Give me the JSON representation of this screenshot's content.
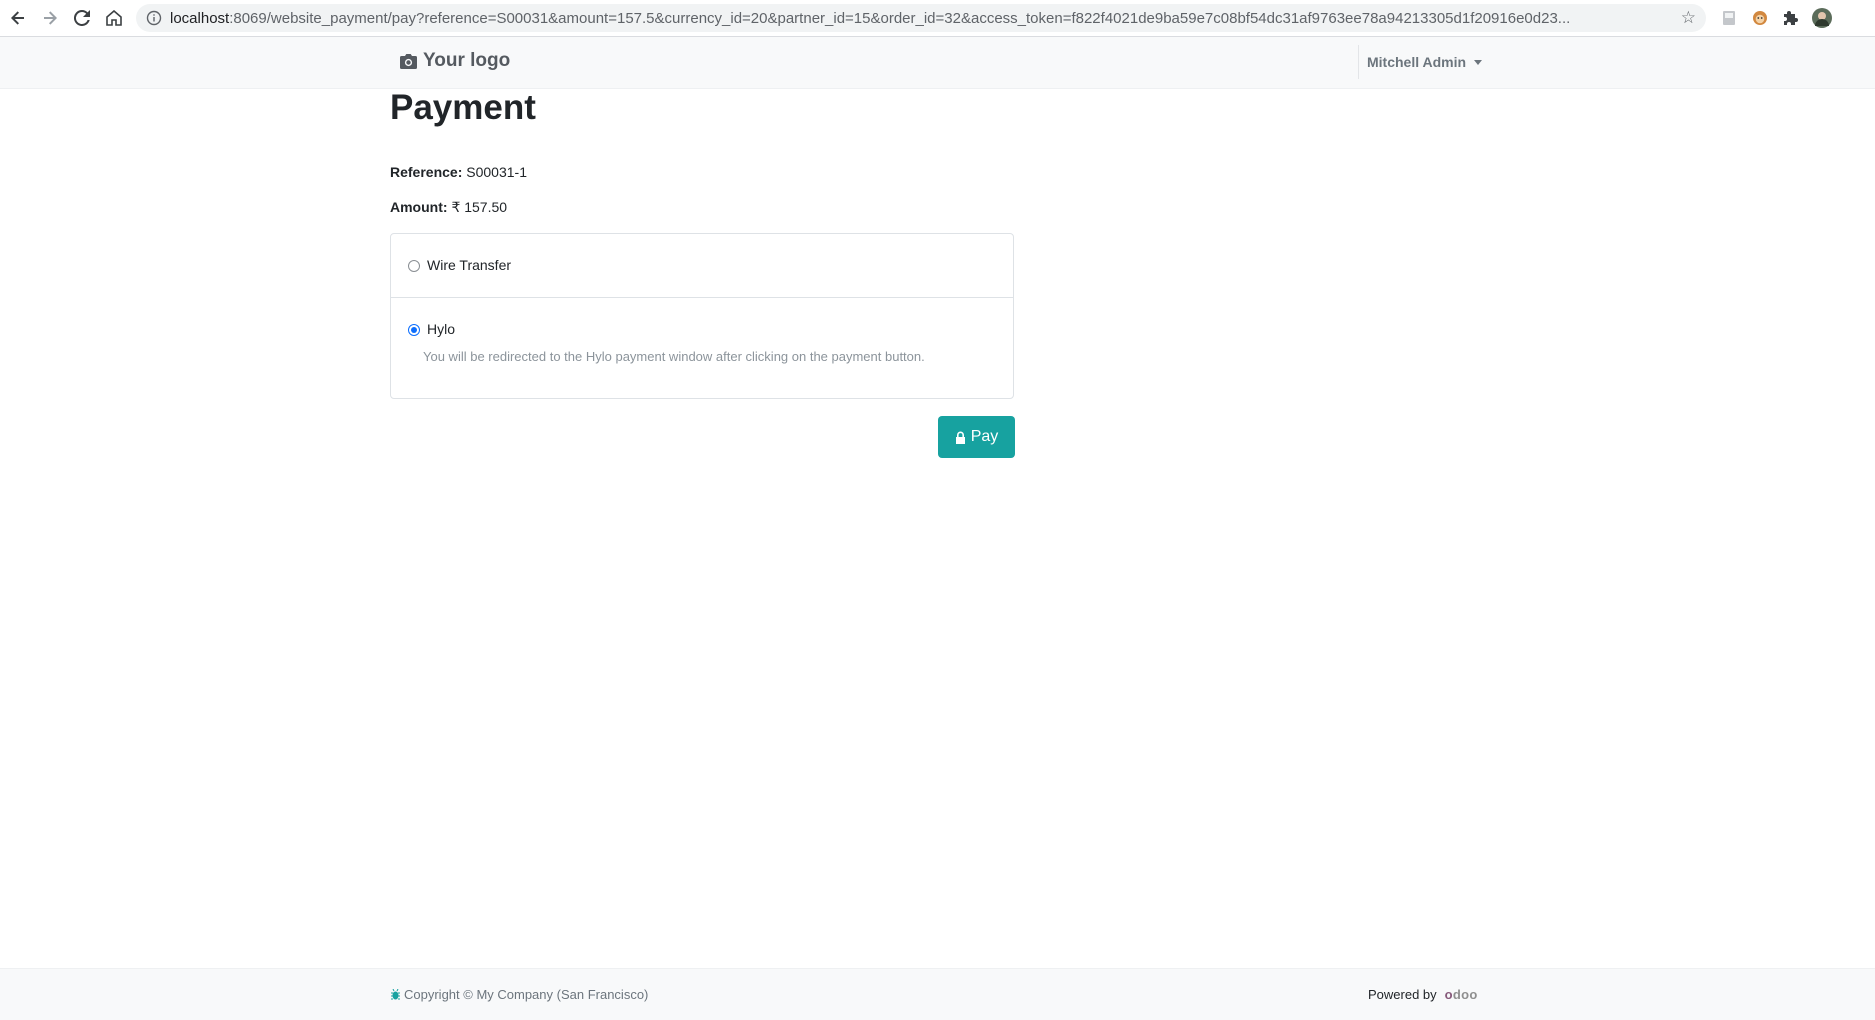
{
  "browser": {
    "url_host": "localhost",
    "url_path": ":8069/website_payment/pay?reference=S00031&amount=157.5&currency_id=20&partner_id=15&order_id=32&access_token=f822f4021de9ba59e7c08bf54dc31af9763ee78a94213305d1f20916e0d23..."
  },
  "header": {
    "logo_text": "Your logo",
    "user_name": "Mitchell Admin"
  },
  "page": {
    "title": "Payment",
    "reference_label": "Reference:",
    "reference_value": "S00031-1",
    "amount_label": "Amount:",
    "amount_value": "₹ 157.50"
  },
  "payment_methods": [
    {
      "label": "Wire Transfer",
      "selected": false
    },
    {
      "label": "Hylo",
      "selected": true,
      "help": "You will be redirected to the Hylo payment window after clicking on the payment button."
    }
  ],
  "pay_button": {
    "label": "Pay"
  },
  "footer": {
    "copyright": "Copyright © My Company (San Francisco)",
    "powered_by": "Powered by",
    "brand": "odoo"
  },
  "colors": {
    "accent": "#17a2a0",
    "radio_selected": "#0d6efd",
    "odoo_purple": "#875a7b",
    "odoo_grey": "#8f8f8f"
  }
}
